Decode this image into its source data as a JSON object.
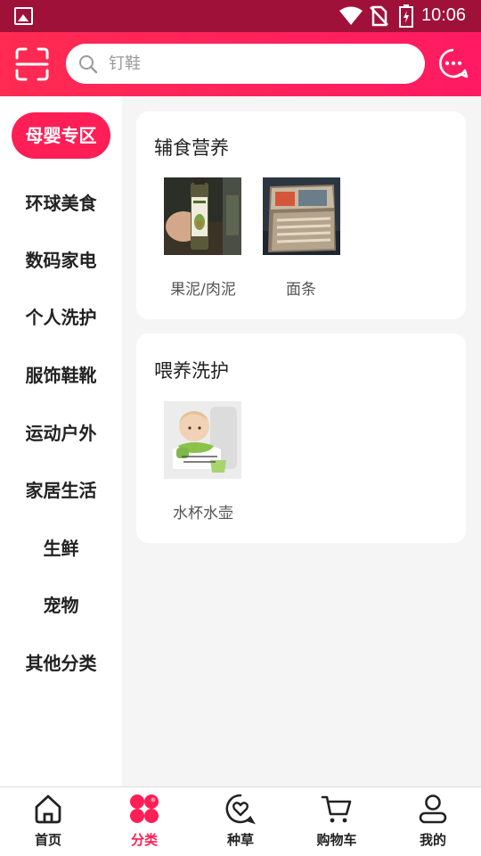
{
  "status_bar": {
    "time": "10:06"
  },
  "search": {
    "placeholder": "钉鞋"
  },
  "sidebar": {
    "items": [
      {
        "label": "母婴专区",
        "active": true
      },
      {
        "label": "环球美食"
      },
      {
        "label": "数码家电"
      },
      {
        "label": "个人洗护"
      },
      {
        "label": "服饰鞋靴"
      },
      {
        "label": "运动户外"
      },
      {
        "label": "家居生活"
      },
      {
        "label": "生鲜"
      },
      {
        "label": "宠物"
      },
      {
        "label": "其他分类"
      }
    ]
  },
  "sections": [
    {
      "title": "辅食营养",
      "items": [
        {
          "label": "果泥/肉泥",
          "image": "oil-bottle-photo"
        },
        {
          "label": "面条",
          "image": "noodle-package-photo"
        }
      ]
    },
    {
      "title": "喂养洗护",
      "items": [
        {
          "label": "水杯水壶",
          "image": "baby-with-cup-photo"
        }
      ]
    }
  ],
  "tabbar": {
    "items": [
      {
        "label": "首页",
        "icon": "home-icon"
      },
      {
        "label": "分类",
        "icon": "category-icon",
        "active": true
      },
      {
        "label": "种草",
        "icon": "heart-bubble-icon"
      },
      {
        "label": "购物车",
        "icon": "cart-icon"
      },
      {
        "label": "我的",
        "icon": "profile-icon"
      }
    ]
  },
  "colors": {
    "accent": "#ff1e56",
    "status_bar": "#a0113a",
    "header": "#ff2b52"
  }
}
